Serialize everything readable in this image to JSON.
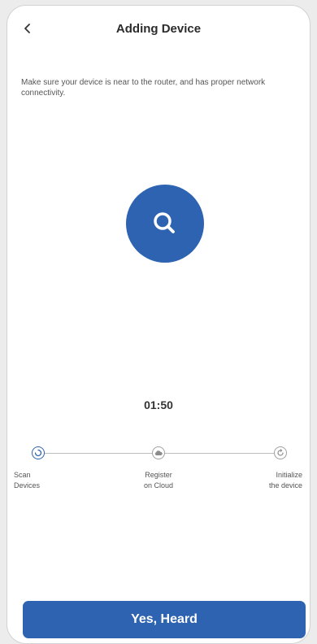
{
  "header": {
    "title": "Adding Device"
  },
  "instructions": {
    "text": "Make sure your device is near to the router, and has proper network connectivity."
  },
  "timer": {
    "value": "01:50"
  },
  "steps": [
    {
      "line1": "Scan",
      "line2": "Devices",
      "icon": "spinner-icon",
      "state": "active"
    },
    {
      "line1": "Register",
      "line2": "on Cloud",
      "icon": "cloud-icon",
      "state": "pending"
    },
    {
      "line1": "Initialize",
      "line2": "the device",
      "icon": "refresh-icon",
      "state": "pending"
    }
  ],
  "cta": {
    "label": "Yes, Heard"
  },
  "colors": {
    "accent": "#2d63b1",
    "inactive": "#a0a0a0"
  }
}
